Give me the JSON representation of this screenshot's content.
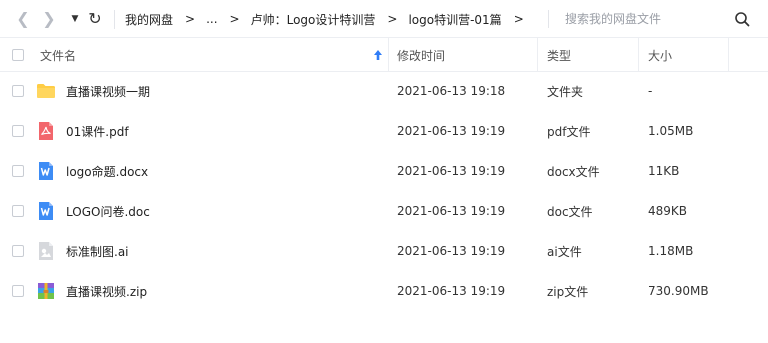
{
  "toolbar": {
    "back_glyph": "❮",
    "forward_glyph": "❯",
    "history_glyph": "▼",
    "refresh_glyph": "↻",
    "icons": [
      "chevron-left-icon",
      "chevron-right-icon",
      "caret-down-icon",
      "refresh-icon"
    ]
  },
  "breadcrumb": {
    "items": [
      "我的网盘",
      "...",
      "卢帅：Logo设计特训营",
      "logo特训营-01篇"
    ],
    "separator": ">"
  },
  "search": {
    "placeholder": "搜索我的网盘文件",
    "icon": "search-icon"
  },
  "header": {
    "name": "文件名",
    "modified": "修改时间",
    "type": "类型",
    "size": "大小",
    "sort_icon": "sort-ascending-icon",
    "sort_color": "#2f7cf6"
  },
  "files": [
    {
      "name": "直播课视频一期",
      "modified": "2021-06-13 19:18",
      "type": "文件夹",
      "size": "-",
      "icon": "folder-icon"
    },
    {
      "name": "01课件.pdf",
      "modified": "2021-06-13 19:19",
      "type": "pdf文件",
      "size": "1.05MB",
      "icon": "pdf-icon"
    },
    {
      "name": "logo命题.docx",
      "modified": "2021-06-13 19:19",
      "type": "docx文件",
      "size": "11KB",
      "icon": "word-icon"
    },
    {
      "name": "LOGO问卷.doc",
      "modified": "2021-06-13 19:19",
      "type": "doc文件",
      "size": "489KB",
      "icon": "word-icon"
    },
    {
      "name": "标准制图.ai",
      "modified": "2021-06-13 19:19",
      "type": "ai文件",
      "size": "1.18MB",
      "icon": "generic-file-icon"
    },
    {
      "name": "直播课视频.zip",
      "modified": "2021-06-13 19:19",
      "type": "zip文件",
      "size": "730.90MB",
      "icon": "zip-archive-icon"
    }
  ],
  "colors": {
    "folder": "#ffcd45",
    "pdf": "#f2666c",
    "word": "#3d8cf5",
    "generic": "#d6d8dc",
    "accent": "#2f7cf6"
  }
}
